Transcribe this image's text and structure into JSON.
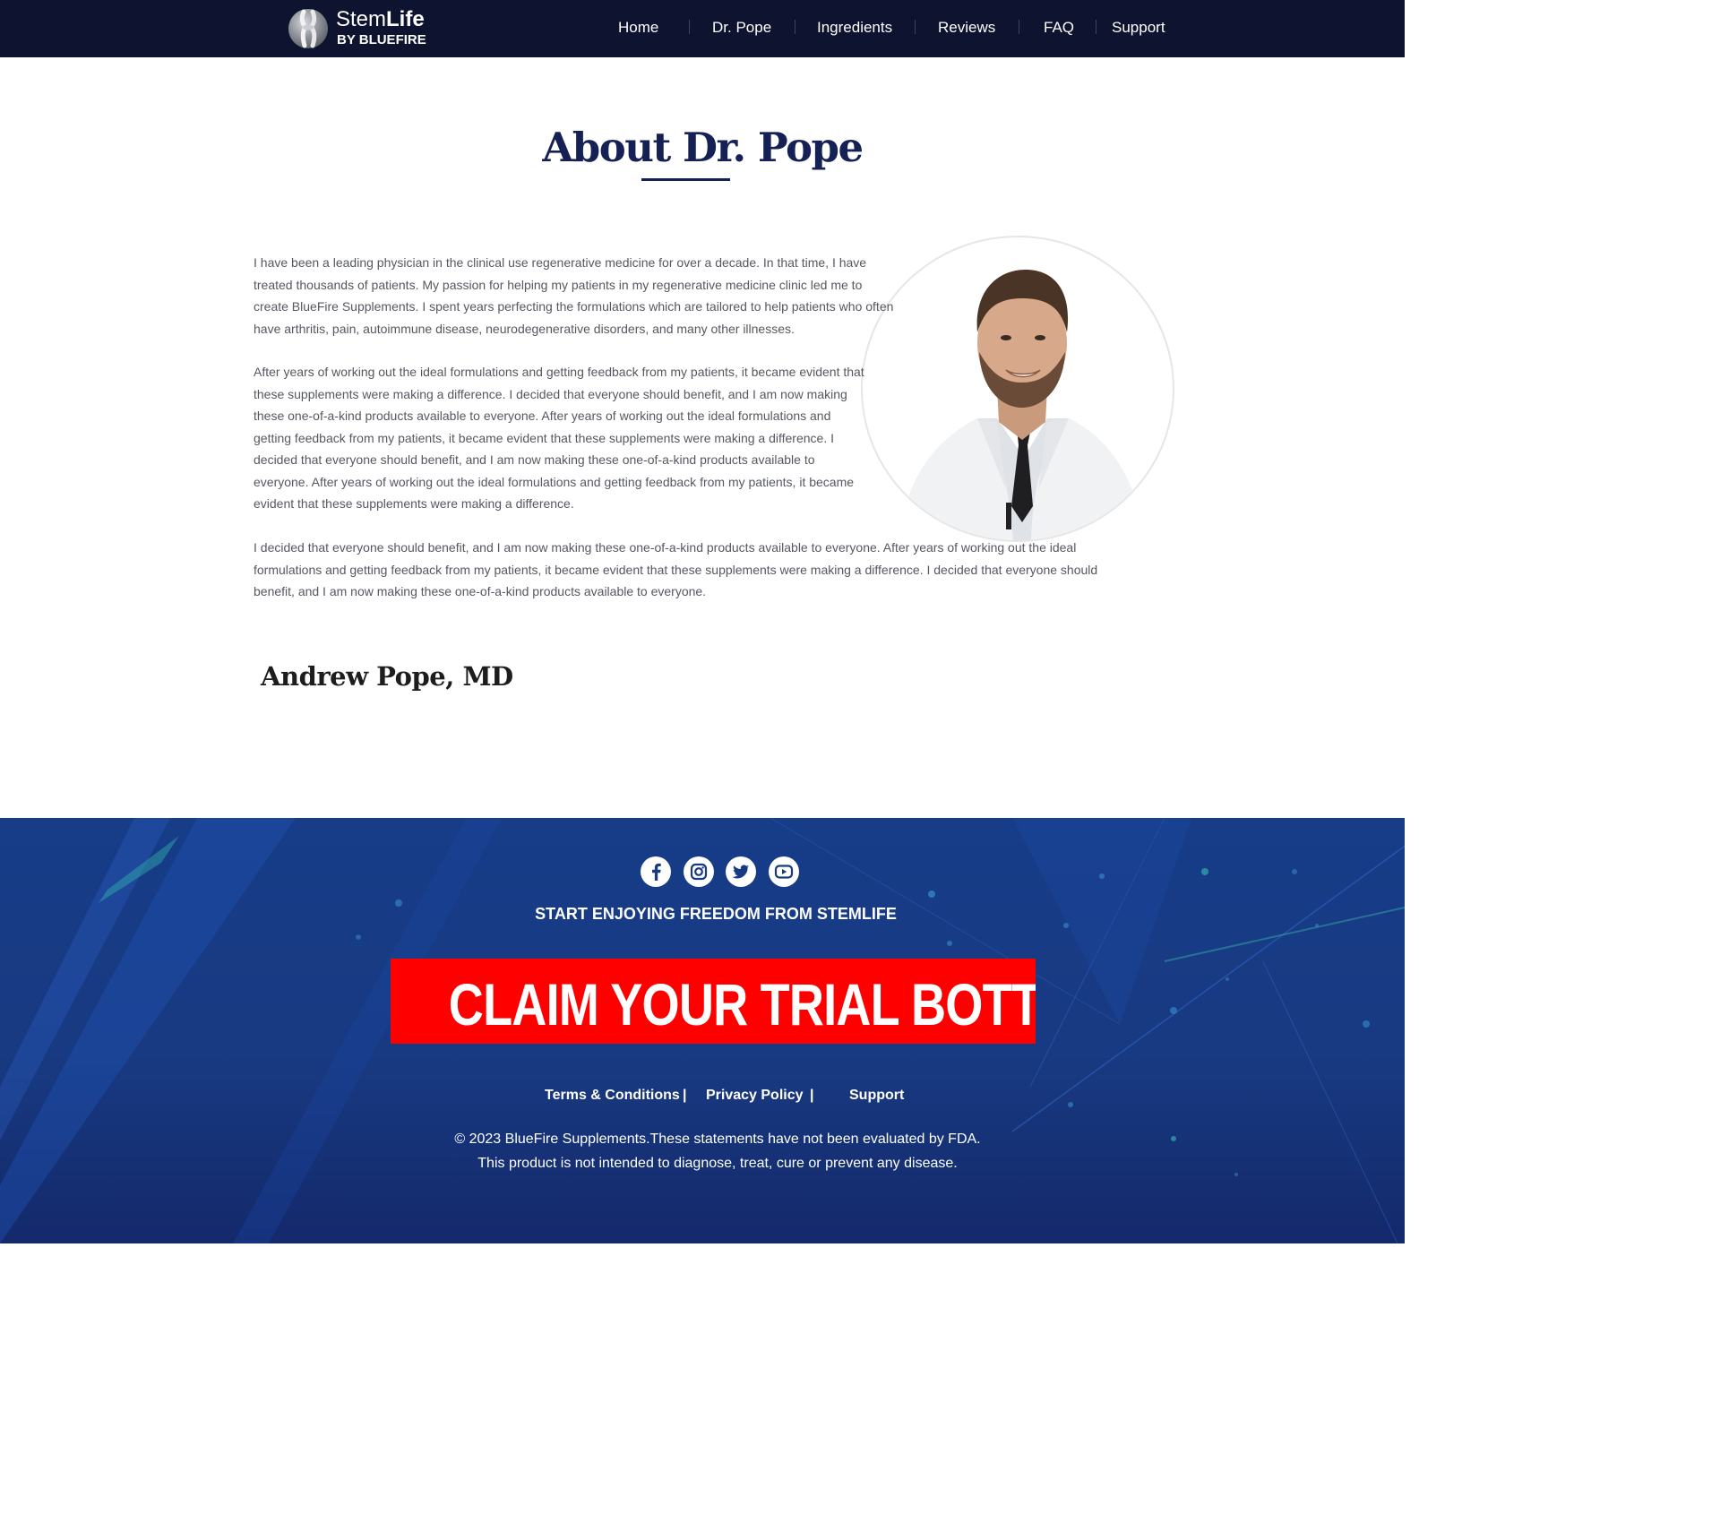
{
  "brand": {
    "logo_word1": "Stem",
    "logo_word2": "Life",
    "logo_sub": "BY BLUEFIRE"
  },
  "nav": {
    "items": [
      "Home",
      "Dr. Pope",
      "Ingredients",
      "Reviews",
      "FAQ",
      "Support"
    ]
  },
  "about": {
    "title": "About Dr. Pope",
    "paragraphs": [
      "I have been a leading physician in the clinical use regenerative medicine for over a decade. In that time, I have treated thousands of patients. My passion for helping my patients in my regenerative medicine clinic led me to create BlueFire Supplements. I spent years perfecting the formulations which are tailored to help patients who often have arthritis, pain, autoimmune disease, neurodegenerative disorders, and many other illnesses.",
      "After years of working out the ideal formulations and getting feedback from my patients, it became evident that these supplements were making a difference. I decided that everyone should benefit, and I am now making these one-of-a-kind products available to everyone. After years of working out the ideal formulations and getting feedback from my patients, it became evident that these supplements were making a difference. I decided that everyone should benefit, and I am now making these one-of-a-kind products available to everyone. After years of working out the ideal formulations and getting feedback from my patients, it became evident that these supplements were making a difference.",
      "I decided that everyone should benefit, and I am now making these one-of-a-kind products available to everyone. After years of working out the ideal formulations and getting feedback from my patients, it became evident that these supplements were making a difference. I decided that everyone should benefit, and I am now making these one-of-a-kind products available to everyone."
    ],
    "signature": "Andrew Pope, MD"
  },
  "footer": {
    "social": [
      "facebook-icon",
      "instagram-icon",
      "twitter-icon",
      "youtube-icon"
    ],
    "tagline": "START ENJOYING FREEDOM FROM STEMLIFE",
    "cta": "CLAIM YOUR TRIAL BOTTLE",
    "links": [
      "Terms & Conditions",
      "Privacy Policy",
      "Support"
    ],
    "separator": "|",
    "legal_line1": "© 2023 BlueFire Supplements.These statements have not been evaluated by FDA.",
    "legal_line2": "This product is not intended to diagnose, treat, cure or prevent any disease."
  },
  "colors": {
    "header_bg": "#0e1430",
    "title": "#152054",
    "body_text": "#555860",
    "footer_bg": "#183a82",
    "cta_bg": "#ff0000"
  }
}
